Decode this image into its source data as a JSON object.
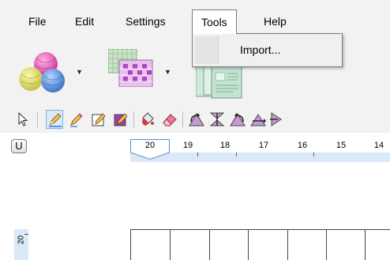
{
  "menu": {
    "file": "File",
    "edit": "Edit",
    "settings": "Settings",
    "tools": "Tools",
    "help": "Help"
  },
  "tools_menu": {
    "items": [
      {
        "label": "Import..."
      }
    ]
  },
  "toolbar": {
    "yarn_icon": "yarn-balls-icon",
    "pattern_icon": "pattern-grid-icon",
    "pages_icon": "pattern-pages-icon"
  },
  "tools": [
    "pointer-icon",
    "pencil-selected-icon",
    "pencil-icon",
    "pencil-box-icon",
    "pencil-fill-box-icon",
    "paint-bucket-icon",
    "eraser-icon",
    "rotate-left-icon",
    "flip-vertical-icon",
    "rotate-right-icon",
    "flip-horizontal-icon",
    "arrow-right-icon"
  ],
  "view": {
    "u_button": "U",
    "ruler_numbers": [
      "20",
      "19",
      "18",
      "17",
      "16",
      "15",
      "14"
    ],
    "side_ruler_number": "20"
  },
  "colors": {
    "menu_bg": "#f2f2f2",
    "ruler_band": "#dbe8f7",
    "selection_blue": "#7fb0e0"
  }
}
